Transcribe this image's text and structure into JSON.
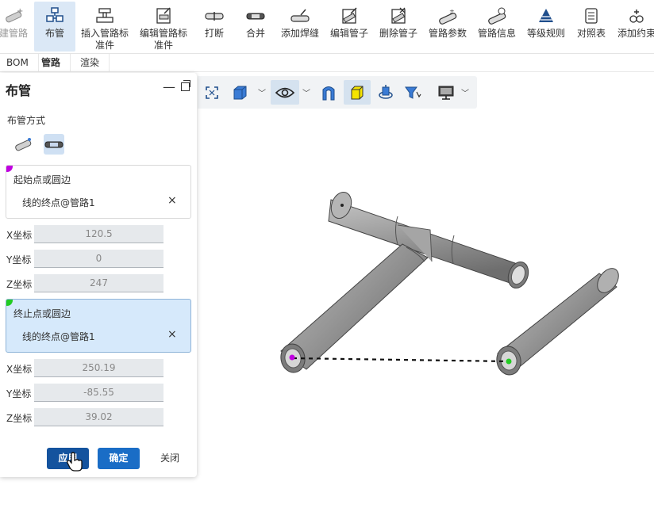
{
  "ribbon": {
    "items": [
      {
        "key": "new_route",
        "label": "建管路",
        "icon": "pipe-plus-icon",
        "state": "dim"
      },
      {
        "key": "route_pipe",
        "label": "布管",
        "icon": "route-pipe-icon",
        "state": "active"
      },
      {
        "key": "insert_fitting",
        "label": "插入管路标\n准件",
        "icon": "insert-fitting-icon",
        "state": "normal"
      },
      {
        "key": "edit_fitting",
        "label": "编辑管路标\n准件",
        "icon": "edit-fitting-icon",
        "state": "normal"
      },
      {
        "key": "break",
        "label": "打断",
        "icon": "break-icon",
        "state": "normal"
      },
      {
        "key": "merge",
        "label": "合并",
        "icon": "merge-icon",
        "state": "normal"
      },
      {
        "key": "add_weld",
        "label": "添加焊缝",
        "icon": "weld-icon",
        "state": "normal"
      },
      {
        "key": "edit_pipe",
        "label": "编辑管子",
        "icon": "edit-pipe-icon",
        "state": "normal"
      },
      {
        "key": "delete_pipe",
        "label": "删除管子",
        "icon": "delete-pipe-icon",
        "state": "normal"
      },
      {
        "key": "route_params",
        "label": "管路参数",
        "icon": "route-params-icon",
        "state": "normal"
      },
      {
        "key": "route_info",
        "label": "管路信息",
        "icon": "route-info-icon",
        "state": "normal"
      },
      {
        "key": "grade_rules",
        "label": "等级规则",
        "icon": "pyramid-icon",
        "state": "normal"
      },
      {
        "key": "lookup_table",
        "label": "对照表",
        "icon": "table-icon",
        "state": "normal"
      },
      {
        "key": "add_constraint",
        "label": "添加约束",
        "icon": "constraint-icon",
        "state": "normal"
      }
    ]
  },
  "tabs": [
    {
      "label": "BOM",
      "active": false
    },
    {
      "label": "管路",
      "active": true
    },
    {
      "label": "渲染",
      "active": false
    }
  ],
  "panel": {
    "title": "布管",
    "minimize_glyph": "—",
    "mode_label": "布管方式",
    "start": {
      "title": "起始点或圆边",
      "value": "线的终点@管路1",
      "clear": "×",
      "marker_color": "#c000e0"
    },
    "start_coords": {
      "x_label": "X坐标",
      "x": "120.5",
      "y_label": "Y坐标",
      "y": "0",
      "z_label": "Z坐标",
      "z": "247"
    },
    "end": {
      "title": "终止点或圆边",
      "value": "线的终点@管路1",
      "clear": "×",
      "marker_color": "#22cc22"
    },
    "end_coords": {
      "x_label": "X坐标",
      "x": "250.19",
      "y_label": "Y坐标",
      "y": "-85.55",
      "z_label": "Z坐标",
      "z": "39.02"
    },
    "buttons": {
      "apply": "应用",
      "ok": "确定",
      "close": "关闭"
    }
  },
  "colors": {
    "accent": "#1a6dc6",
    "start_marker": "#c000e0",
    "end_marker": "#22cc22",
    "pipe": "#9a9a9a"
  }
}
